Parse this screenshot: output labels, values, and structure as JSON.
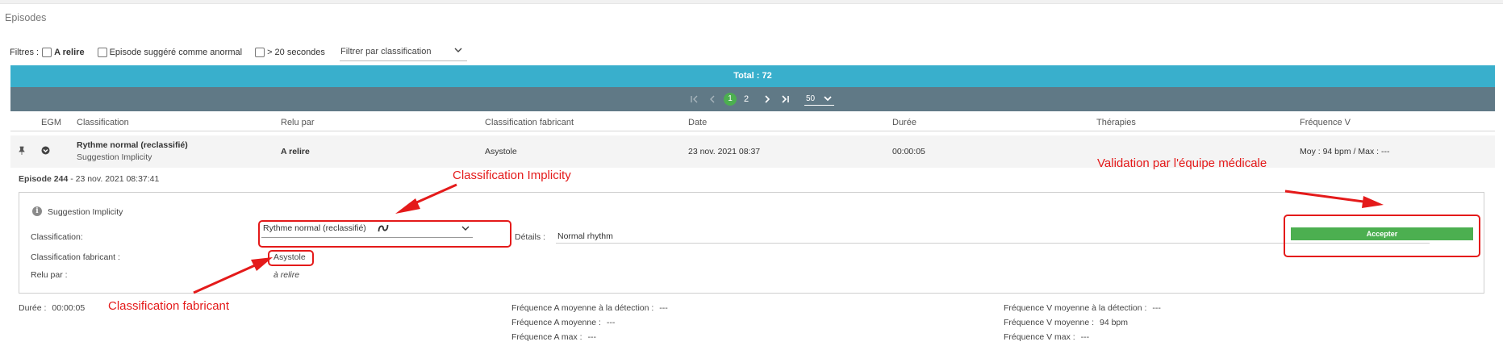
{
  "page": {
    "title": "Episodes"
  },
  "filters": {
    "label": "Filtres :",
    "a_relire": "A relire",
    "anormal": "Episode suggéré comme anormal",
    "duree": "> 20 secondes",
    "classification_placeholder": "Filtrer par classification"
  },
  "summary": {
    "total": "Total : 72"
  },
  "pagination": {
    "current_page": "1",
    "next_page": "2",
    "per_page": "50"
  },
  "table": {
    "headers": {
      "egm": "EGM",
      "classification": "Classification",
      "relu_par": "Relu par",
      "classification_fabricant": "Classification fabricant",
      "date": "Date",
      "duree": "Durée",
      "therapies": "Thérapies",
      "frequence_v": "Fréquence V"
    },
    "row": {
      "classification": "Rythme normal (reclassifié)",
      "suggestion": "Suggestion Implicity",
      "relu_par": "A relire",
      "classification_fabricant": "Asystole",
      "date": "23 nov. 2021 08:37",
      "duree": "00:00:05",
      "therapies": "",
      "frequence_v": "Moy : 94 bpm / Max : ---"
    }
  },
  "episode": {
    "number": "Episode 244",
    "datetime": " - 23 nov. 2021 08:37:41",
    "panel_title": "Suggestion Implicity",
    "classification_label": "Classification:",
    "classification_value": "Rythme normal (reclassifié)",
    "classification_fabricant_label": "Classification fabricant :",
    "classification_fabricant_value": "Asystole",
    "relu_par_label": "Relu par :",
    "relu_par_value": "à relire",
    "details_label": "Détails :",
    "details_value": "Normal rhythm",
    "accept_label": "Accepter"
  },
  "stats": {
    "duree_label": "Durée :",
    "duree_value": "00:00:05",
    "freq_a_detection_label": "Fréquence A moyenne à la détection :",
    "freq_a_detection_value": "---",
    "freq_a_moy_label": "Fréquence A moyenne :",
    "freq_a_moy_value": "---",
    "freq_a_max_label": "Fréquence A max :",
    "freq_a_max_value": "---",
    "freq_v_detection_label": "Fréquence V moyenne à la détection :",
    "freq_v_detection_value": "---",
    "freq_v_moy_label": "Fréquence V moyenne :",
    "freq_v_moy_value": "94 bpm",
    "freq_v_max_label": "Fréquence V max :",
    "freq_v_max_value": "---"
  },
  "annotations": {
    "implicity": "Classification Implicity",
    "fabricant": "Classification fabricant",
    "validation": "Validation par l'équipe médicale"
  },
  "colors": {
    "total_bar": "#39afcc",
    "pager_bar": "#607986",
    "accept": "#4caf50",
    "annotation": "#e41a1a"
  },
  "icons": [
    "pin-icon",
    "chevron-circle-icon",
    "info-icon",
    "reclassified-icon",
    "chevron-down-icon",
    "first-page-icon",
    "prev-page-icon",
    "next-page-icon",
    "last-page-icon"
  ]
}
